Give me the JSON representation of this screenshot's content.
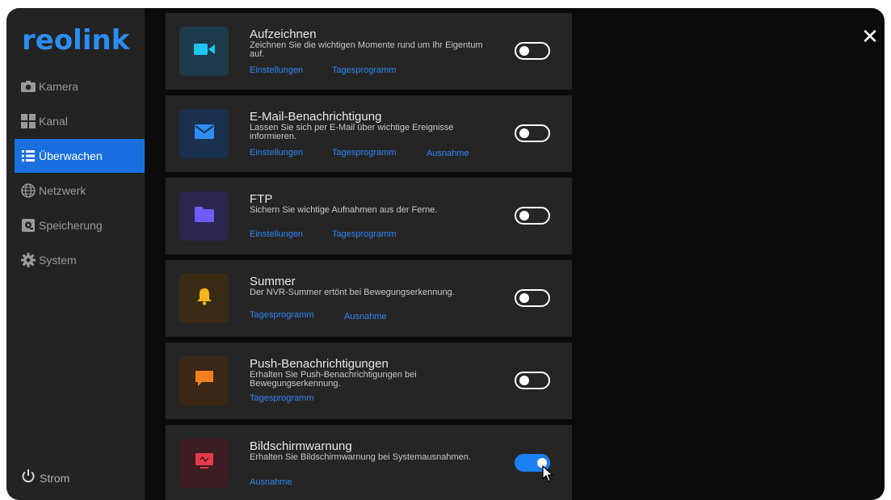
{
  "app": {
    "logo": "reolink",
    "close_glyph": "✕"
  },
  "sidebar": {
    "items": [
      {
        "label": "Kamera",
        "icon": "camera-icon",
        "active": false
      },
      {
        "label": "Kanal",
        "icon": "grid-icon",
        "active": false
      },
      {
        "label": "Überwachen",
        "icon": "list-icon",
        "active": true
      },
      {
        "label": "Netzwerk",
        "icon": "globe-icon",
        "active": false
      },
      {
        "label": "Speicherung",
        "icon": "storage-icon",
        "active": false
      },
      {
        "label": "System",
        "icon": "gear-icon",
        "active": false
      }
    ],
    "power_label": "Strom"
  },
  "cards": [
    {
      "title": "Aufzeichnen",
      "desc": "Zeichnen Sie die wichtigen Momente rund um Ihr Eigentum auf.",
      "links": [
        "Einstellungen",
        "Tagesprogramm"
      ],
      "icon": "video-camera-icon",
      "tile_color": "#1d3a4a",
      "glyph_color": "#1cc6f0",
      "enabled": false
    },
    {
      "title": "E-Mail-Benachrichtigung",
      "desc": "Lassen Sie sich per E-Mail über wichtige Ereignisse informieren.",
      "links": [
        "Einstellungen",
        "Tagesprogramm",
        "Ausnahme"
      ],
      "icon": "envelope-icon",
      "tile_color": "#1b2f4f",
      "glyph_color": "#2f8cf5",
      "enabled": false
    },
    {
      "title": "FTP",
      "desc": "Sichern Sie wichtige Aufnahmen aus der Ferne.",
      "links": [
        "Einstellungen",
        "Tagesprogramm"
      ],
      "icon": "folder-icon",
      "tile_color": "#2b2750",
      "glyph_color": "#6f5cf5",
      "enabled": false
    },
    {
      "title": "Summer",
      "desc": "Der NVR-Summer ertönt bei Bewegungserkennung.",
      "links": [
        "Tagesprogramm",
        "Ausnahme"
      ],
      "icon": "bell-icon",
      "tile_color": "#3a2c14",
      "glyph_color": "#f5b51c",
      "enabled": false
    },
    {
      "title": "Push-Benachrichtigungen",
      "desc": "Erhalten Sie Push-Benachrichtigungen bei Bewegungserkennung.",
      "links": [
        "Tagesprogramm"
      ],
      "icon": "chat-bubble-icon",
      "tile_color": "#3a2716",
      "glyph_color": "#f07f1c",
      "enabled": false
    },
    {
      "title": "Bildschirmwarnung",
      "desc": "Erhalten Sie Bildschirmwarnung bei Systemausnahmen.",
      "links": [
        "Ausnahme"
      ],
      "icon": "monitor-warning-icon",
      "tile_color": "#3c1d22",
      "glyph_color": "#e83a4a",
      "enabled": true
    }
  ]
}
